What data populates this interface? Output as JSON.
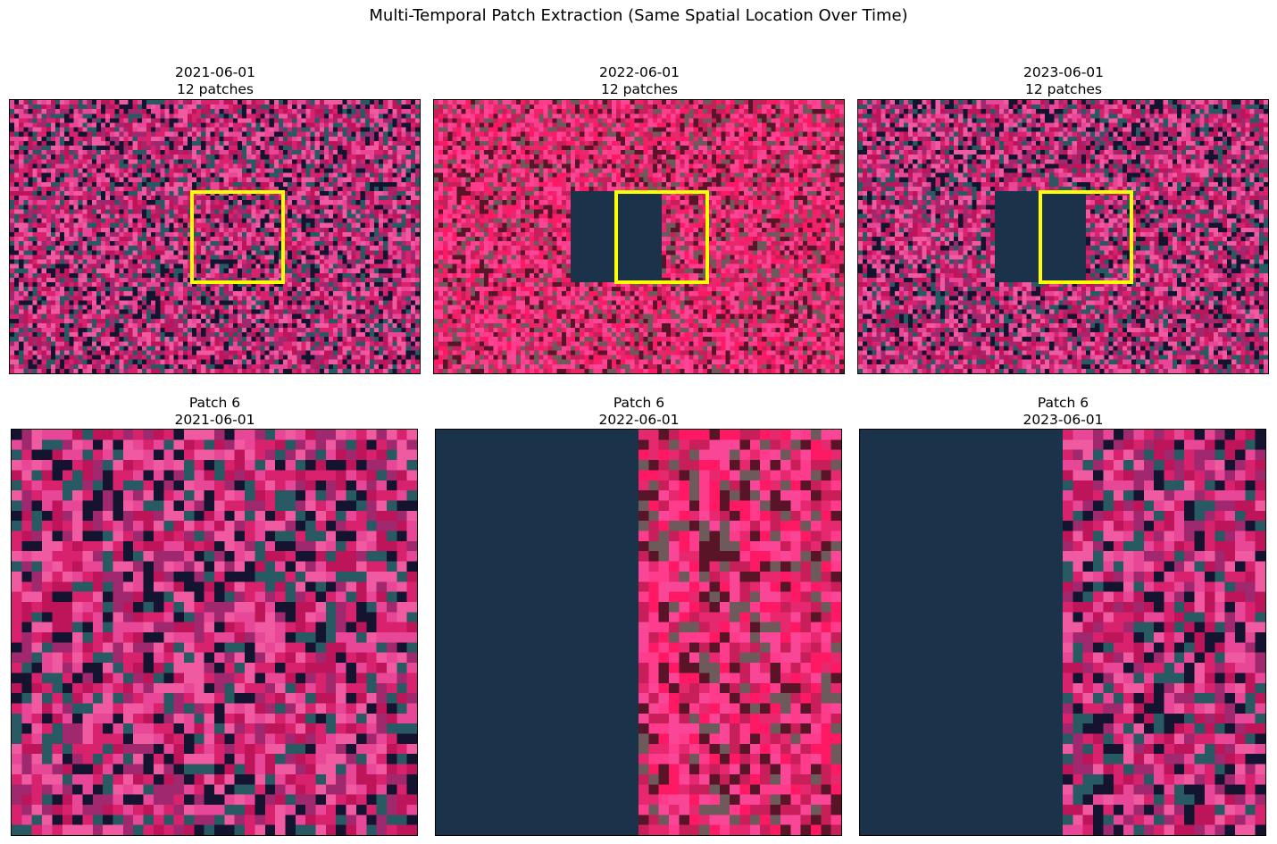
{
  "figure": {
    "title": "Multi-Temporal Patch Extraction (Same Spatial Location Over Time)"
  },
  "colors": {
    "background": "#ffffff",
    "highlight_box": "#ffff00",
    "nodata_fill": "#1a334b"
  },
  "scenes": [
    {
      "date": "2021-06-01",
      "patch_count_label": "12 patches",
      "nodata_region": false,
      "style": "normal"
    },
    {
      "date": "2022-06-01",
      "patch_count_label": "12 patches",
      "nodata_region": true,
      "style": "bright"
    },
    {
      "date": "2023-06-01",
      "patch_count_label": "12 patches",
      "nodata_region": true,
      "style": "normal"
    }
  ],
  "patches": [
    {
      "label": "Patch 6",
      "date": "2021-06-01",
      "nodata_fraction": 0.0
    },
    {
      "label": "Patch 6",
      "date": "2022-06-01",
      "nodata_fraction": 0.5
    },
    {
      "label": "Patch 6",
      "date": "2023-06-01",
      "nodata_fraction": 0.5
    }
  ]
}
